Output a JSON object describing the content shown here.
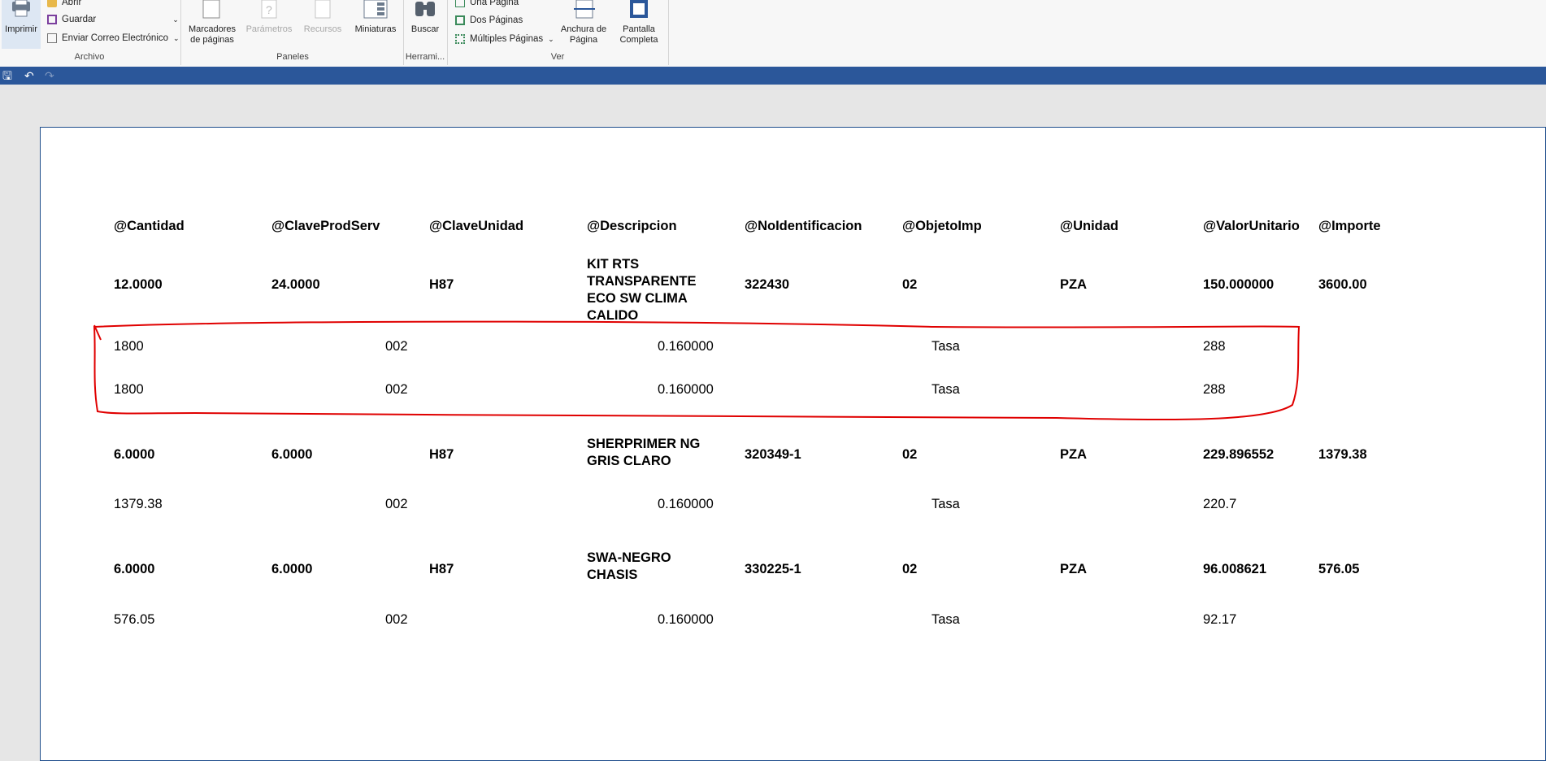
{
  "ribbon": {
    "print": "Imprimir",
    "open": "Abrir",
    "save": "Guardar",
    "email": "Enviar Correo Electrónico",
    "bookmarks": "Marcadores de páginas",
    "parameters": "Parámetros",
    "resources": "Recursos",
    "thumbnails": "Miniaturas",
    "search": "Buscar",
    "one_page": "Una Página",
    "two_pages": "Dos Páginas",
    "multiple_pages": "Múltiples Páginas",
    "page_width": "Anchura de Página",
    "full_screen": "Pantalla Completa",
    "groups": {
      "archivo": "Archivo",
      "paneles": "Paneles",
      "herramientas": "Herrami...",
      "ver": "Ver"
    }
  },
  "report": {
    "headers": [
      "@Cantidad",
      "@ClaveProdServ",
      "@ClaveUnidad",
      "@Descripcion",
      "@NoIdentificacion",
      "@ObjetoImp",
      "@Unidad",
      "@ValorUnitario",
      "@Importe"
    ],
    "items": [
      {
        "cantidad": "12.0000",
        "clave_prod_serv": "24.0000",
        "clave_unidad": "H87",
        "descripcion": "KIT RTS TRANSPARENTE ECO SW CLIMA CALIDO",
        "no_identificacion": "322430",
        "objeto_imp": "02",
        "unidad": "PZA",
        "valor_unitario": "150.000000",
        "importe": "3600.00",
        "taxes": [
          {
            "base": "1800",
            "impuesto": "002",
            "tasa": "0.160000",
            "tipo": "Tasa",
            "importe": "288"
          },
          {
            "base": "1800",
            "impuesto": "002",
            "tasa": "0.160000",
            "tipo": "Tasa",
            "importe": "288"
          }
        ]
      },
      {
        "cantidad": "6.0000",
        "clave_prod_serv": "6.0000",
        "clave_unidad": "H87",
        "descripcion": "SHERPRIMER NG GRIS CLARO",
        "no_identificacion": "320349-1",
        "objeto_imp": "02",
        "unidad": "PZA",
        "valor_unitario": "229.896552",
        "importe": "1379.38",
        "taxes": [
          {
            "base": "1379.38",
            "impuesto": "002",
            "tasa": "0.160000",
            "tipo": "Tasa",
            "importe": "220.7"
          }
        ]
      },
      {
        "cantidad": "6.0000",
        "clave_prod_serv": "6.0000",
        "clave_unidad": "H87",
        "descripcion": "SWA-NEGRO CHASIS",
        "no_identificacion": "330225-1",
        "objeto_imp": "02",
        "unidad": "PZA",
        "valor_unitario": "96.008621",
        "importe": "576.05",
        "taxes": [
          {
            "base": "576.05",
            "impuesto": "002",
            "tasa": "0.160000",
            "tipo": "Tasa",
            "importe": "92.17"
          }
        ]
      }
    ]
  },
  "colors": {
    "accent_bar": "#2b579a",
    "annotation": "#e00000"
  }
}
